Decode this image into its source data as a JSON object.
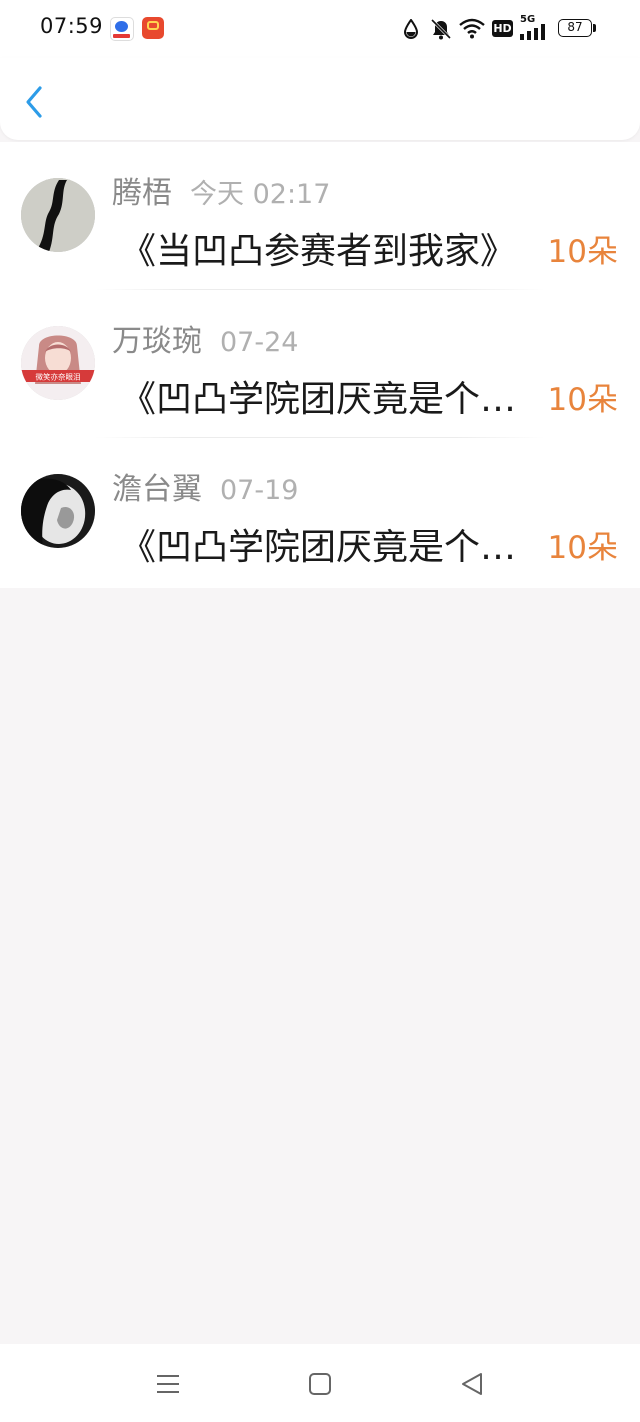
{
  "status_bar": {
    "time": "07:59",
    "battery": "87",
    "signal": "5G",
    "hd_label": "HD"
  },
  "header": {
    "back_icon": "chevron-left-icon",
    "accent_color": "#2d9ce8"
  },
  "list": {
    "items": [
      {
        "name": "腾梧",
        "time": "今天 02:17",
        "title": "《当凹凸参赛者到我家》",
        "flowers": "10朵"
      },
      {
        "name": "万琰琬",
        "time": "07-24",
        "title": "《凹凸学院团厌竟是个…",
        "flowers": "10朵"
      },
      {
        "name": "澹台翼",
        "time": "07-19",
        "title": "《凹凸学院团厌竟是个…",
        "flowers": "10朵"
      }
    ],
    "avatar_badge_text": "微笑亦奈眼泪"
  },
  "colors": {
    "flowers": "#e8843c",
    "name": "#8a8a8a",
    "title": "#1a1a1a",
    "background": "#f7f5f6"
  }
}
